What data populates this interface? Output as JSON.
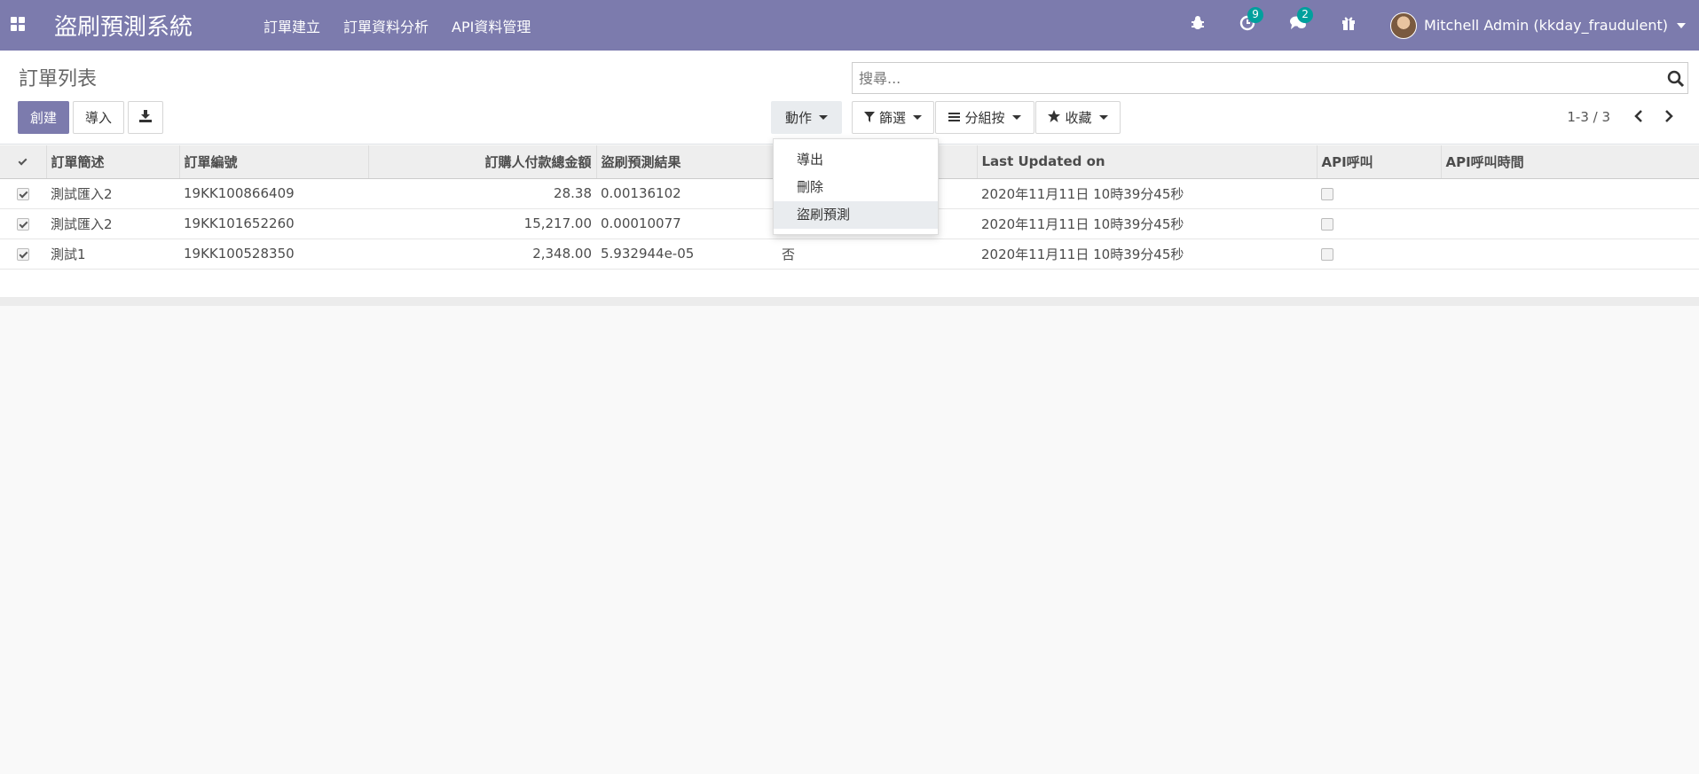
{
  "navbar": {
    "brand": "盜刷預測系統",
    "menu": [
      "訂單建立",
      "訂單資料分析",
      "API資料管理"
    ],
    "activity_count": "9",
    "message_count": "2",
    "user_name": "Mitchell Admin (kkday_fraudulent)"
  },
  "control": {
    "title": "訂單列表",
    "create_label": "創建",
    "import_label": "導入",
    "search_placeholder": "搜尋...",
    "action_label": "動作",
    "filter_label": "篩選",
    "groupby_label": "分組按",
    "favorites_label": "收藏",
    "pager_text": "1-3 / 3"
  },
  "action_menu": {
    "items": [
      "導出",
      "刪除",
      "盜刷預測"
    ],
    "active_index": 2
  },
  "table": {
    "columns": [
      "訂單簡述",
      "訂單編號",
      "訂購人付款總金額",
      "盜刷預測結果",
      "",
      "Last Updated on",
      "API呼叫",
      "API呼叫時間"
    ],
    "rows": [
      {
        "desc": "測試匯入2",
        "order_no": "19KK100866409",
        "amount": "28.38",
        "prediction": "0.00136102",
        "flag": "",
        "updated": "2020年11月11日 10時39分45秒",
        "api_time": ""
      },
      {
        "desc": "測試匯入2",
        "order_no": "19KK101652260",
        "amount": "15,217.00",
        "prediction": "0.00010077",
        "flag": "",
        "updated": "2020年11月11日 10時39分45秒",
        "api_time": ""
      },
      {
        "desc": "測試1",
        "order_no": "19KK100528350",
        "amount": "2,348.00",
        "prediction": "5.932944e-05",
        "flag": "否",
        "updated": "2020年11月11日 10時39分45秒",
        "api_time": ""
      }
    ]
  },
  "colors": {
    "brand": "#7c7bad",
    "badge": "#00a09d"
  }
}
